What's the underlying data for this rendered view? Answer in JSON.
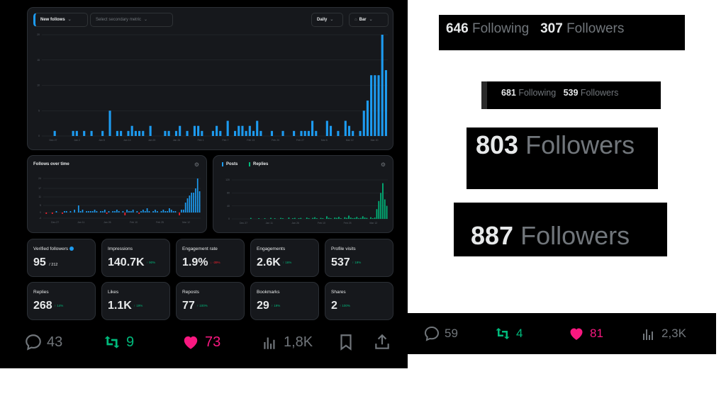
{
  "dashboard": {
    "primary_metric": "New follows",
    "secondary_metric_placeholder": "Select secondary metric",
    "granularity": "Daily",
    "chart_kind": "Bar",
    "date_ticks": [
      "Dec 27",
      "Jan 2",
      "Jan 8",
      "Jan 14",
      "Jan 20",
      "Jan 26",
      "Feb 1",
      "Feb 7",
      "Feb 13",
      "Feb 20",
      "Feb 27",
      "Mar 6",
      "Mar 12",
      "Mar 20"
    ],
    "y_ticks": [
      "0",
      "5",
      "10",
      "15",
      "20"
    ],
    "follows_over_time": {
      "title": "Follows over time",
      "y_ticks": [
        "-4",
        "0",
        "5",
        "11",
        "17",
        "24"
      ],
      "x_ticks": [
        "Dec 27",
        "Jan 11",
        "Jan 26",
        "Feb 10",
        "Feb 25",
        "Mar 12"
      ]
    },
    "posts_replies": {
      "posts_label": "Posts",
      "replies_label": "Replies",
      "y_ticks": [
        "0",
        "40",
        "80",
        "120"
      ],
      "x_ticks": [
        "Dec 27",
        "Jan 11",
        "Jan 26",
        "Feb 10",
        "Feb 25",
        "Mar 12"
      ]
    },
    "stats": [
      {
        "label": "Verified followers",
        "value": "95",
        "sub": "/ 212",
        "change": "",
        "dir": ""
      },
      {
        "label": "Impressions",
        "value": "140.7K",
        "sub": "",
        "change": "↑ 90%",
        "dir": "up"
      },
      {
        "label": "Engagement rate",
        "value": "1.9%",
        "sub": "",
        "change": "↓ -39%",
        "dir": "down"
      },
      {
        "label": "Engagements",
        "value": "2.6K",
        "sub": "",
        "change": "↑ 16%",
        "dir": "up"
      },
      {
        "label": "Profile visits",
        "value": "537",
        "sub": "",
        "change": "↑ 19%",
        "dir": "up"
      },
      {
        "label": "Replies",
        "value": "268",
        "sub": "",
        "change": "↑ 14%",
        "dir": "up"
      },
      {
        "label": "Likes",
        "value": "1.1K",
        "sub": "",
        "change": "↑ 19%",
        "dir": "up"
      },
      {
        "label": "Reposts",
        "value": "77",
        "sub": "",
        "change": "↑ 100%",
        "dir": "up"
      },
      {
        "label": "Bookmarks",
        "value": "29",
        "sub": "",
        "change": "↑ 19%",
        "dir": "up"
      },
      {
        "label": "Shares",
        "value": "2",
        "sub": "",
        "change": "↑ 100%",
        "dir": "up"
      }
    ],
    "actions": {
      "replies": "43",
      "reposts": "9",
      "likes": "73",
      "views": "1,8K"
    }
  },
  "chart_data": [
    {
      "type": "bar",
      "title": "",
      "series": [
        {
          "name": "New follows",
          "values": [
            0,
            0,
            0,
            1,
            0,
            0,
            0,
            0,
            1,
            1,
            0,
            1,
            0,
            1,
            0,
            0,
            1,
            0,
            5,
            0,
            1,
            1,
            0,
            1,
            2,
            1,
            1,
            1,
            0,
            2,
            0,
            0,
            0,
            1,
            1,
            0,
            1,
            2,
            0,
            1,
            0,
            2,
            2,
            1,
            0,
            0,
            1,
            2,
            1,
            0,
            3,
            0,
            1,
            2,
            2,
            1,
            2,
            1,
            3,
            1,
            0,
            0,
            1,
            0,
            0,
            1,
            0,
            0,
            1,
            0,
            1,
            1,
            1,
            3,
            1,
            0,
            0,
            3,
            2,
            0,
            1,
            0,
            3,
            2,
            1,
            0,
            1,
            5,
            7,
            12,
            12,
            12,
            20,
            13
          ]
        }
      ],
      "ylim": [
        0,
        20
      ],
      "color": "#1d9bf0"
    },
    {
      "type": "bar",
      "title": "Follows over time",
      "series": [
        {
          "name": "",
          "values": [
            0,
            -1,
            0,
            0,
            -1,
            0,
            1,
            0,
            0,
            -1,
            1,
            1,
            0,
            1,
            0,
            2,
            0,
            5,
            1,
            2,
            0,
            1,
            1,
            1,
            1,
            2,
            1,
            0,
            1,
            1,
            2,
            -1,
            1,
            0,
            1,
            1,
            2,
            1,
            0,
            1,
            -2,
            2,
            1,
            1,
            2,
            0,
            1,
            -1,
            1,
            2,
            1,
            3,
            1,
            0,
            1,
            2,
            1,
            0,
            1,
            2,
            1,
            1,
            3,
            2,
            1,
            1,
            0,
            -2,
            2,
            2,
            7,
            10,
            12,
            14,
            14,
            17,
            24,
            15
          ]
        }
      ],
      "ylim": [
        -4,
        24
      ],
      "colors": {
        "positive": "#1d9bf0",
        "negative": "#f4212e"
      }
    },
    {
      "type": "bar",
      "title": "",
      "series": [
        {
          "name": "Posts",
          "values": [
            0,
            0,
            0,
            0,
            0,
            0,
            0,
            0,
            0,
            0,
            0,
            0,
            0,
            0,
            0,
            0,
            0,
            0,
            0,
            0,
            0,
            0,
            0,
            0,
            0,
            0,
            0,
            0,
            0,
            0,
            0,
            0,
            0,
            0,
            0,
            0,
            0,
            0,
            0,
            0,
            0,
            0,
            0,
            0,
            0,
            0,
            0,
            0,
            0,
            0,
            0,
            0,
            0,
            0,
            0,
            0,
            0,
            0,
            0,
            0,
            0,
            0,
            0,
            0,
            0,
            0,
            0,
            0,
            0,
            0,
            0,
            0,
            0,
            0,
            0,
            0,
            0,
            0
          ]
        },
        {
          "name": "Replies",
          "values": [
            0,
            0,
            0,
            0,
            0,
            0,
            0,
            0,
            0,
            3,
            0,
            0,
            0,
            2,
            0,
            0,
            2,
            0,
            0,
            3,
            0,
            2,
            0,
            0,
            3,
            2,
            0,
            0,
            4,
            0,
            2,
            3,
            0,
            2,
            3,
            0,
            0,
            4,
            2,
            0,
            3,
            5,
            2,
            0,
            3,
            2,
            0,
            8,
            3,
            2,
            0,
            4,
            3,
            6,
            2,
            0,
            5,
            3,
            10,
            4,
            2,
            3,
            6,
            2,
            3,
            8,
            4,
            3,
            0,
            5,
            2,
            4,
            30,
            55,
            80,
            110,
            60,
            40
          ]
        }
      ],
      "ylim": [
        0,
        120
      ],
      "colors": {
        "Posts": "#1d9bf0",
        "Replies": "#00ba7c"
      }
    }
  ],
  "snippets": {
    "s1": {
      "following_count": "646",
      "following_label": "Following",
      "followers_count": "307",
      "followers_label": "Followers"
    },
    "s2": {
      "following_count": "681",
      "following_label": "Following",
      "followers_count": "539",
      "followers_label": "Followers"
    },
    "s3": {
      "followers_count": "803",
      "followers_label": "Followers"
    },
    "s4": {
      "followers_count": "887",
      "followers_label": "Followers"
    },
    "s5": {
      "replies": "59",
      "reposts": "4",
      "likes": "81",
      "views": "2,3K"
    }
  }
}
